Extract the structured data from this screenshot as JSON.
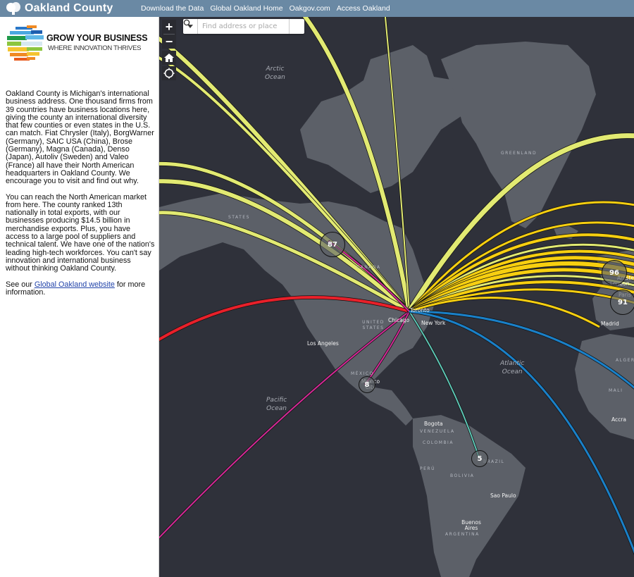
{
  "header": {
    "logo_icon": "tree-icon",
    "title": "Oakland County",
    "nav": [
      {
        "label": "Download the Data"
      },
      {
        "label": "Global Oakland Home"
      },
      {
        "label": "Oakgov.com"
      },
      {
        "label": "Access Oakland"
      }
    ]
  },
  "sidebar": {
    "brand_title": "GROW YOUR BUSINESS",
    "brand_subtitle": "WHERE INNOVATION THRIVES",
    "paragraph1": "Oakland County is Michigan's international business address. One thousand firms from 39 countries have business locations here, giving the county an international diversity that few counties or even states in the U.S. can match. Fiat Chrysler (Italy), BorgWarner (Germany), SAIC USA (China), Brose (Germany), Magna (Canada), Denso (Japan), Autoliv (Sweden) and Valeo (France) all have their North American headquarters in Oakland County. We encourage you to visit and find out why.",
    "paragraph2": "You can reach the North American market from here. The county ranked 13th nationally in total exports, with our businesses producing $14.5 billion in merchandise exports. Plus, you have access to a large pool of suppliers and technical talent. We have one of the nation's leading high-tech workforces. You can't say innovation and international business without thinking Oakland County.",
    "see_prefix": "See our ",
    "link_label": "Global Oakland website",
    "see_suffix": " for more information."
  },
  "map": {
    "controls": {
      "zoom_in": "+",
      "zoom_out": "−",
      "home_icon": "home-icon",
      "locate_icon": "locate-icon"
    },
    "search": {
      "placeholder": "Find address or place",
      "search_icon": "search-icon",
      "dropdown_icon": "caret-down-icon"
    },
    "colors": {
      "land": "#5c6068",
      "water": "#2f313a",
      "flow_yellow_light": "#e2ea72",
      "flow_yellow": "#f7cf10",
      "flow_red": "#e8202a",
      "flow_magenta": "#d42a97",
      "flow_blue": "#1a80c8",
      "flow_teal": "#5dc6b5"
    },
    "ocean_labels": [
      {
        "text": "Arctic\nOcean",
        "key": "arctic"
      },
      {
        "text": "Atlantic\nOcean",
        "key": "atlantic"
      },
      {
        "text": "Pacific\nOcean",
        "key": "pacific"
      }
    ],
    "country_labels": [
      "GREENLAND",
      "STATES",
      "CANADA",
      "UNITED STATES",
      "MÉXICO",
      "VENEZUELA",
      "COLOMBIA",
      "PERÚ",
      "BRAZIL",
      "BOLIVIA",
      "ARGENTINA",
      "ALGERIA",
      "MALI"
    ],
    "city_labels": [
      "Toronto",
      "Chicago",
      "New York",
      "Los Angeles",
      "Mexico City",
      "Bogota",
      "Sao Paulo",
      "Buenos Aires",
      "Madrid",
      "Amsterdam",
      "London",
      "Paris",
      "Accra"
    ],
    "clusters": [
      {
        "count": "87"
      },
      {
        "count": "96"
      },
      {
        "count": "91"
      },
      {
        "count": "8"
      },
      {
        "count": "5"
      }
    ]
  }
}
